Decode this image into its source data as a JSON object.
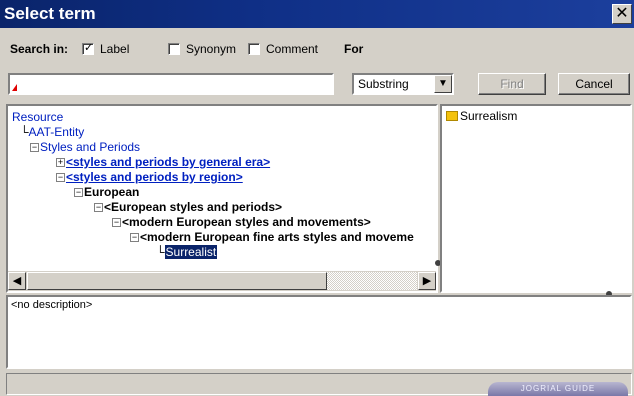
{
  "window": {
    "title": "Select term",
    "close_glyph": "✕"
  },
  "search": {
    "search_in_label": "Search in:",
    "options": [
      {
        "label": "Label",
        "checked": true
      },
      {
        "label": "Synonym",
        "checked": false
      },
      {
        "label": "Comment",
        "checked": false
      }
    ],
    "for_label": "For",
    "query_value": "",
    "mode_selected": "Substring",
    "find_label": "Find",
    "cancel_label": "Cancel"
  },
  "tree": {
    "nodes": [
      {
        "text": "Resource",
        "style": "blue",
        "prefix": ""
      },
      {
        "text": "AAT-Entity",
        "style": "blue",
        "prefix": "└"
      },
      {
        "text": "Styles and Periods",
        "style": "blue",
        "prefix": "⊟"
      },
      {
        "text": "<styles and periods by general  era>",
        "style": "boldblue",
        "prefix": "⊞"
      },
      {
        "text": "<styles and periods by  region>",
        "style": "boldblue",
        "prefix": "⊟"
      },
      {
        "text": "European",
        "style": "boldblack",
        "prefix": "⊟"
      },
      {
        "text": "<European styles and  periods>",
        "style": "boldblack",
        "prefix": "⊟"
      },
      {
        "text": "<modern European styles and  movements>",
        "style": "boldblack",
        "prefix": "⊟"
      },
      {
        "text": "<modern European fine arts  styles and moveme",
        "style": "boldblack",
        "prefix": "⊟"
      },
      {
        "text": "Surrealist",
        "style": "selected",
        "prefix": "└"
      }
    ]
  },
  "results": {
    "items": [
      {
        "label": "Surrealism",
        "icon": "term-icon"
      }
    ]
  },
  "description": {
    "text": "<no description>"
  },
  "footer": {
    "guide_label": "JOGRIAL GUIDE"
  },
  "colors": {
    "titlebar": "#0a246a",
    "link": "#0020c0",
    "selection": "#0a246a",
    "face": "#d4d0c8"
  }
}
